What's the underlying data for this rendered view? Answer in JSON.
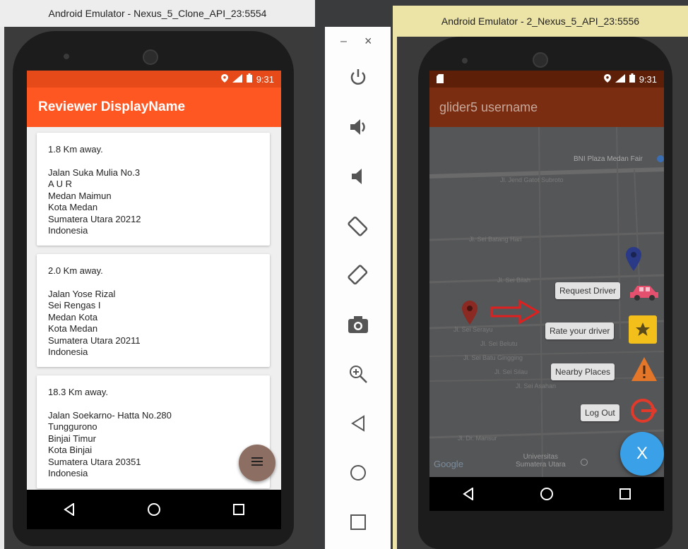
{
  "left_emulator": {
    "window_title": "Android Emulator - Nexus_5_Clone_API_23:5554",
    "status_time": "9:31",
    "app_title": "Reviewer DisplayName",
    "cards": [
      {
        "distance": "1.8 Km away.",
        "address_lines": [
          "Jalan Suka Mulia No.3",
          "A U R",
          "Medan Maimun",
          "Kota Medan",
          "Sumatera Utara 20212",
          "Indonesia"
        ]
      },
      {
        "distance": "2.0 Km away.",
        "address_lines": [
          "Jalan Yose Rizal",
          "Sei Rengas I",
          "Medan Kota",
          "Kota Medan",
          "Sumatera Utara 20211",
          "Indonesia"
        ]
      },
      {
        "distance": "18.3 Km away.",
        "address_lines": [
          "Jalan Soekarno- Hatta No.280",
          "Tunggurono",
          "Binjai Timur",
          "Kota Binjai",
          "Sumatera Utara 20351",
          "Indonesia"
        ]
      }
    ]
  },
  "toolbar": {
    "minimize": "–",
    "close": "×",
    "buttons": [
      "power-icon",
      "volume-up-icon",
      "volume-down-icon",
      "rotate-left-icon",
      "rotate-right-icon",
      "camera-icon",
      "zoom-icon",
      "back-icon",
      "home-icon",
      "overview-icon"
    ]
  },
  "right_emulator": {
    "window_title": "Android Emulator - 2_Nexus_5_API_23:5556",
    "status_time": "9:31",
    "app_title": "glider5 username",
    "map_labels": {
      "poi": "BNI Plaza Medan Fair",
      "road1": "Jl. Jend Gatot Subroto",
      "road2": "Jl. Sei Batang Hari",
      "road3": "Jl. Sei Bilah",
      "road4": "Jl. Sei Serayu",
      "road5": "Jl. Sei Belutu",
      "road6": "Jl. Sei Batu Gingging",
      "road7": "Jl. Sei Silau",
      "road8": "Jl. Sei Asahan",
      "road9": "Jl. Dr. Mansur",
      "univ": "Universitas\nSumatera Utara",
      "google": "Google"
    },
    "fab_actions": [
      {
        "label": "Request Driver",
        "icon": "car-icon"
      },
      {
        "label": "Rate your driver",
        "icon": "star-icon"
      },
      {
        "label": "Nearby Places",
        "icon": "warning-icon"
      },
      {
        "label": "Log Out",
        "icon": "logout-icon"
      }
    ],
    "fab_main": "X",
    "colors": {
      "appbar": "#7a2d10",
      "fab": "#3aa0e8",
      "star_bg": "#f3c01b"
    }
  },
  "colors": {
    "left_appbar": "#ff5722",
    "left_statusbar": "#e64a19",
    "left_fab": "#8d6e63"
  }
}
